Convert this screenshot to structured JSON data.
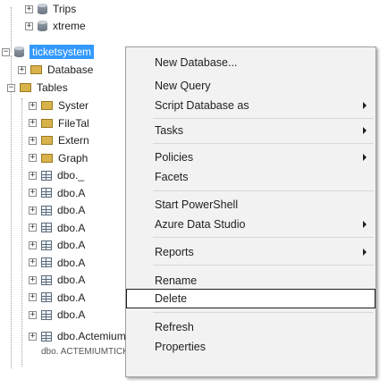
{
  "tree": {
    "top_nodes": [
      {
        "label": "Trips",
        "icon": "database-icon"
      },
      {
        "label": "xtreme",
        "icon": "database-icon"
      }
    ],
    "selected_db": {
      "label": "ticketsystem",
      "icon": "database-icon"
    },
    "children": [
      {
        "label": "Database",
        "icon": "folder-icon"
      },
      {
        "label": "Tables",
        "icon": "folder-icon"
      }
    ],
    "table_children": [
      {
        "label": "Syster",
        "icon": "folder-icon"
      },
      {
        "label": "FileTal",
        "icon": "folder-icon"
      },
      {
        "label": "Extern",
        "icon": "folder-icon"
      },
      {
        "label": "Graph",
        "icon": "folder-icon"
      },
      {
        "label": "dbo._",
        "icon": "table-icon"
      },
      {
        "label": "dbo.A",
        "icon": "table-icon"
      },
      {
        "label": "dbo.A",
        "icon": "table-icon"
      },
      {
        "label": "dbo.A",
        "icon": "table-icon"
      },
      {
        "label": "dbo.A",
        "icon": "table-icon"
      },
      {
        "label": "dbo.A",
        "icon": "table-icon"
      },
      {
        "label": "dbo.A",
        "icon": "table-icon"
      },
      {
        "label": "dbo.A",
        "icon": "table-icon"
      },
      {
        "label": "dbo.A",
        "icon": "table-icon"
      }
    ],
    "bottom_row": {
      "label": "dbo.ActemiumTicket_ActemiumEmployee",
      "icon": "table-icon"
    },
    "cut_row": {
      "label": "dbo. ACTEMIUMTICKETCHANGE"
    }
  },
  "menu": {
    "items": [
      {
        "label": "New Database...",
        "submenu": false
      },
      {
        "label": "New Query",
        "submenu": false
      },
      {
        "label": "Script Database as",
        "submenu": true
      },
      {
        "label": "Tasks",
        "submenu": true
      },
      {
        "label": "Policies",
        "submenu": true
      },
      {
        "label": "Facets",
        "submenu": false
      },
      {
        "label": "Start PowerShell",
        "submenu": false
      },
      {
        "label": "Azure Data Studio",
        "submenu": true
      },
      {
        "label": "Reports",
        "submenu": true
      },
      {
        "label": "Rename",
        "submenu": false
      },
      {
        "label": "Delete",
        "submenu": false
      },
      {
        "label": "Refresh",
        "submenu": false
      },
      {
        "label": "Properties",
        "submenu": false
      }
    ]
  },
  "colors": {
    "selection": "#3399ff",
    "menu_bg": "#f2f2f2",
    "menu_border": "#a0a0a0"
  }
}
